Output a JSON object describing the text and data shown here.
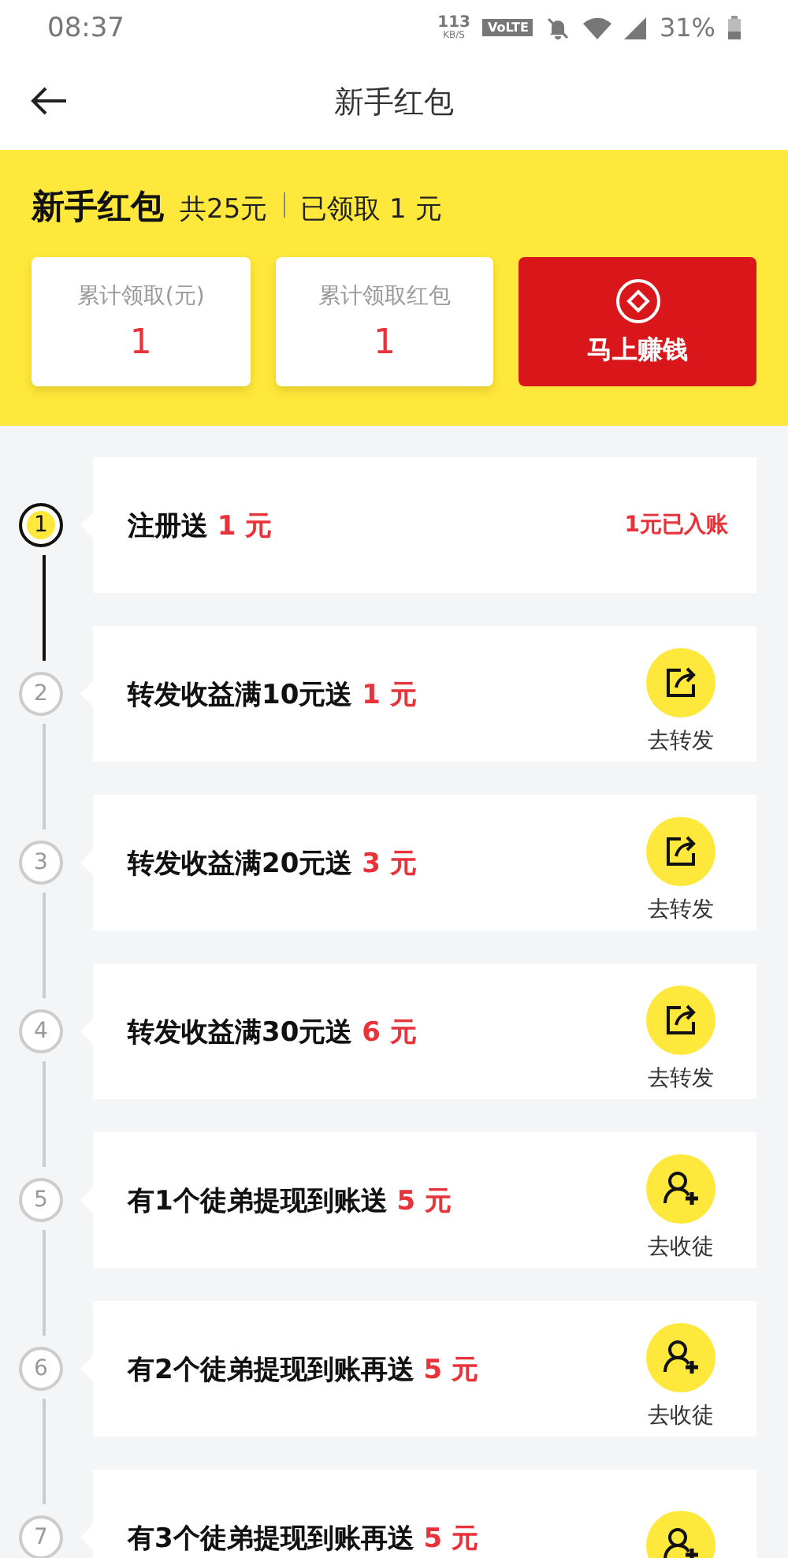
{
  "status_bar": {
    "time": "08:37",
    "speed": "113",
    "speed_unit": "KB/S",
    "network_badge": "VoLTE",
    "battery": "31%"
  },
  "header": {
    "title": "新手红包"
  },
  "summary": {
    "title": "新手红包",
    "total": "共25元",
    "claimed": "已领取 1 元",
    "stats": [
      {
        "label": "累计领取(元)",
        "value": "1"
      },
      {
        "label": "累计领取红包",
        "value": "1"
      }
    ],
    "earn_button": "马上赚钱"
  },
  "tasks": [
    {
      "step": "1",
      "selected": true,
      "title": "注册送",
      "amount": "1 元",
      "kind": "done",
      "status": "1元已入账"
    },
    {
      "step": "2",
      "selected": false,
      "title": "转发收益满10元送",
      "amount": "1 元",
      "kind": "share",
      "action": "去转发"
    },
    {
      "step": "3",
      "selected": false,
      "title": "转发收益满20元送",
      "amount": "3 元",
      "kind": "share",
      "action": "去转发"
    },
    {
      "step": "4",
      "selected": false,
      "title": "转发收益满30元送",
      "amount": "6 元",
      "kind": "share",
      "action": "去转发"
    },
    {
      "step": "5",
      "selected": false,
      "title": "有1个徒弟提现到账送",
      "amount": "5 元",
      "kind": "recruit",
      "action": "去收徒"
    },
    {
      "step": "6",
      "selected": false,
      "title": "有2个徒弟提现到账再送",
      "amount": "5 元",
      "kind": "recruit",
      "action": "去收徒"
    },
    {
      "step": "7",
      "selected": false,
      "title": "有3个徒弟提现到账再送",
      "amount": "5 元",
      "kind": "recruit"
    }
  ]
}
